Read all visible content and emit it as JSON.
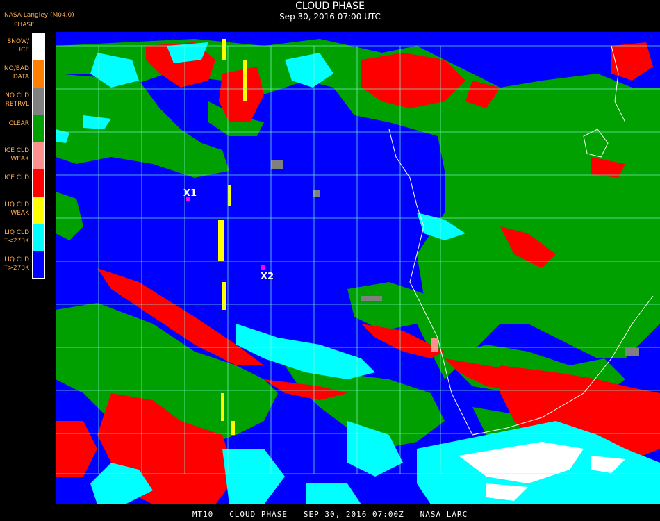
{
  "header": {
    "producer": "NASA Langley (M04.0)",
    "title": "CLOUD PHASE",
    "subtitle": "Sep 30, 2016 07:00 UTC"
  },
  "legend": {
    "title": "PHASE",
    "items": [
      {
        "label": "SNOW/\nICE",
        "color": "#ffffff"
      },
      {
        "label": "NO/BAD\nDATA",
        "color": "#ff8000"
      },
      {
        "label": "NO CLD\nRETRVL",
        "color": "#808080"
      },
      {
        "label": "CLEAR",
        "color": "#00a000"
      },
      {
        "label": "ICE CLD\nWEAK",
        "color": "#ff9090"
      },
      {
        "label": "ICE CLD",
        "color": "#ff0000"
      },
      {
        "label": "LIQ CLD\nWEAK",
        "color": "#ffff00"
      },
      {
        "label": "LIQ CLD\nT<273K",
        "color": "#00ffff"
      },
      {
        "label": "LIQ CLD\nT>273K",
        "color": "#0000ff"
      }
    ]
  },
  "markers": [
    {
      "label": "X1"
    },
    {
      "label": "X2"
    }
  ],
  "footer": "MT10   CLOUD PHASE   SEP 30, 2016 07:00Z   NASA LARC"
}
